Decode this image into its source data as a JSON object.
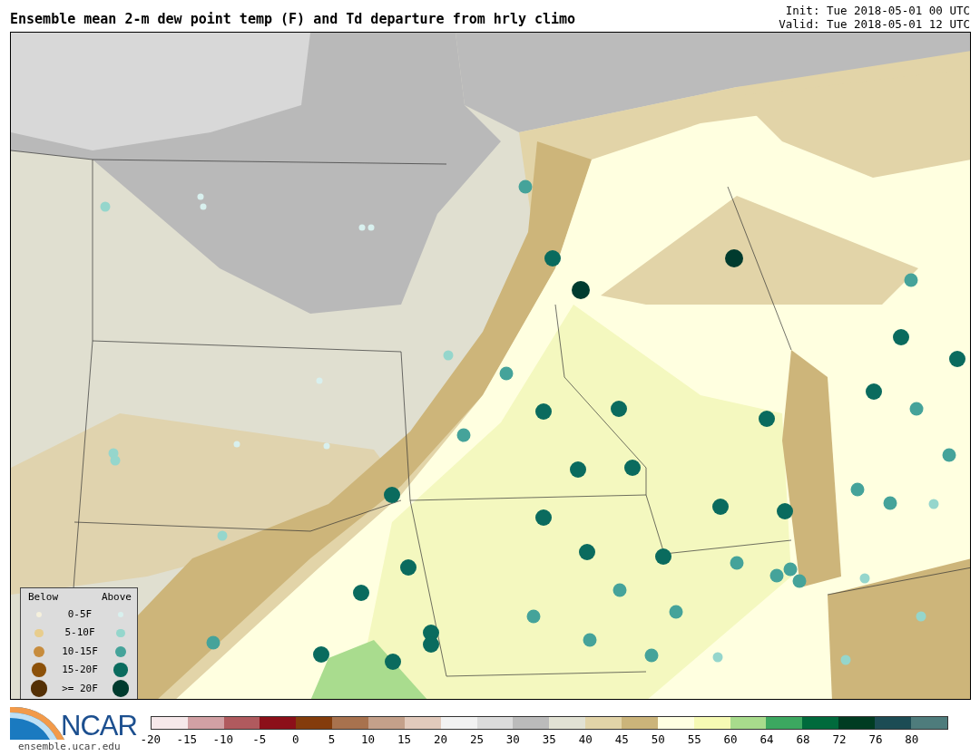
{
  "title": "Ensemble mean 2-m dew point temp (F) and Td departure from hrly climo",
  "init": "Init: Tue 2018-05-01 00 UTC",
  "valid": "Valid: Tue 2018-05-01 12 UTC",
  "legend": {
    "below_heading": "Below",
    "above_heading": "Above",
    "rows": [
      {
        "label": "0-5F",
        "below": {
          "color": "#f5f0dc"
        },
        "above": {
          "color": "#d8f0ee"
        }
      },
      {
        "label": "5-10F",
        "below": {
          "color": "#e8cd8d"
        },
        "above": {
          "color": "#95d6cc"
        }
      },
      {
        "label": "10-15F",
        "below": {
          "color": "#c78c3d"
        },
        "above": {
          "color": "#45a39a"
        }
      },
      {
        "label": "15-20F",
        "below": {
          "color": "#8c510a"
        },
        "above": {
          "color": "#0a6b5e"
        }
      },
      {
        "label": ">= 20F",
        "below": {
          "color": "#543005"
        },
        "above": {
          "color": "#003b2e"
        }
      }
    ]
  },
  "logo": {
    "text": "NCAR",
    "url": "ensemble.ucar.edu"
  },
  "colorbar": {
    "swatches": [
      {
        "color": "#f6e8ea"
      },
      {
        "color": "#d2a0a4"
      },
      {
        "color": "#b05a5e"
      },
      {
        "color": "#8c1019"
      },
      {
        "color": "#843c0c"
      },
      {
        "color": "#a8724e"
      },
      {
        "color": "#c4a08a"
      },
      {
        "color": "#e2cabc"
      },
      {
        "color": "#f2f2f2"
      },
      {
        "color": "#dcdcdc"
      },
      {
        "color": "#bbbbbb"
      },
      {
        "color": "#e2e2d4"
      },
      {
        "color": "#e2d4a8"
      },
      {
        "color": "#cbb47a"
      },
      {
        "color": "#ffffe2"
      },
      {
        "color": "#f6fab4"
      },
      {
        "color": "#a8dc8c"
      },
      {
        "color": "#3ca860"
      },
      {
        "color": "#006a3c"
      },
      {
        "color": "#003c22"
      },
      {
        "color": "#1c4c54"
      },
      {
        "color": "#4e7c7c"
      }
    ],
    "ticks": [
      "-20",
      "-15",
      "-10",
      "-5",
      "0",
      "5",
      "10",
      "15",
      "20",
      "25",
      "30",
      "35",
      "40",
      "45",
      "50",
      "55",
      "60",
      "64",
      "68",
      "72",
      "76",
      "80"
    ]
  }
}
